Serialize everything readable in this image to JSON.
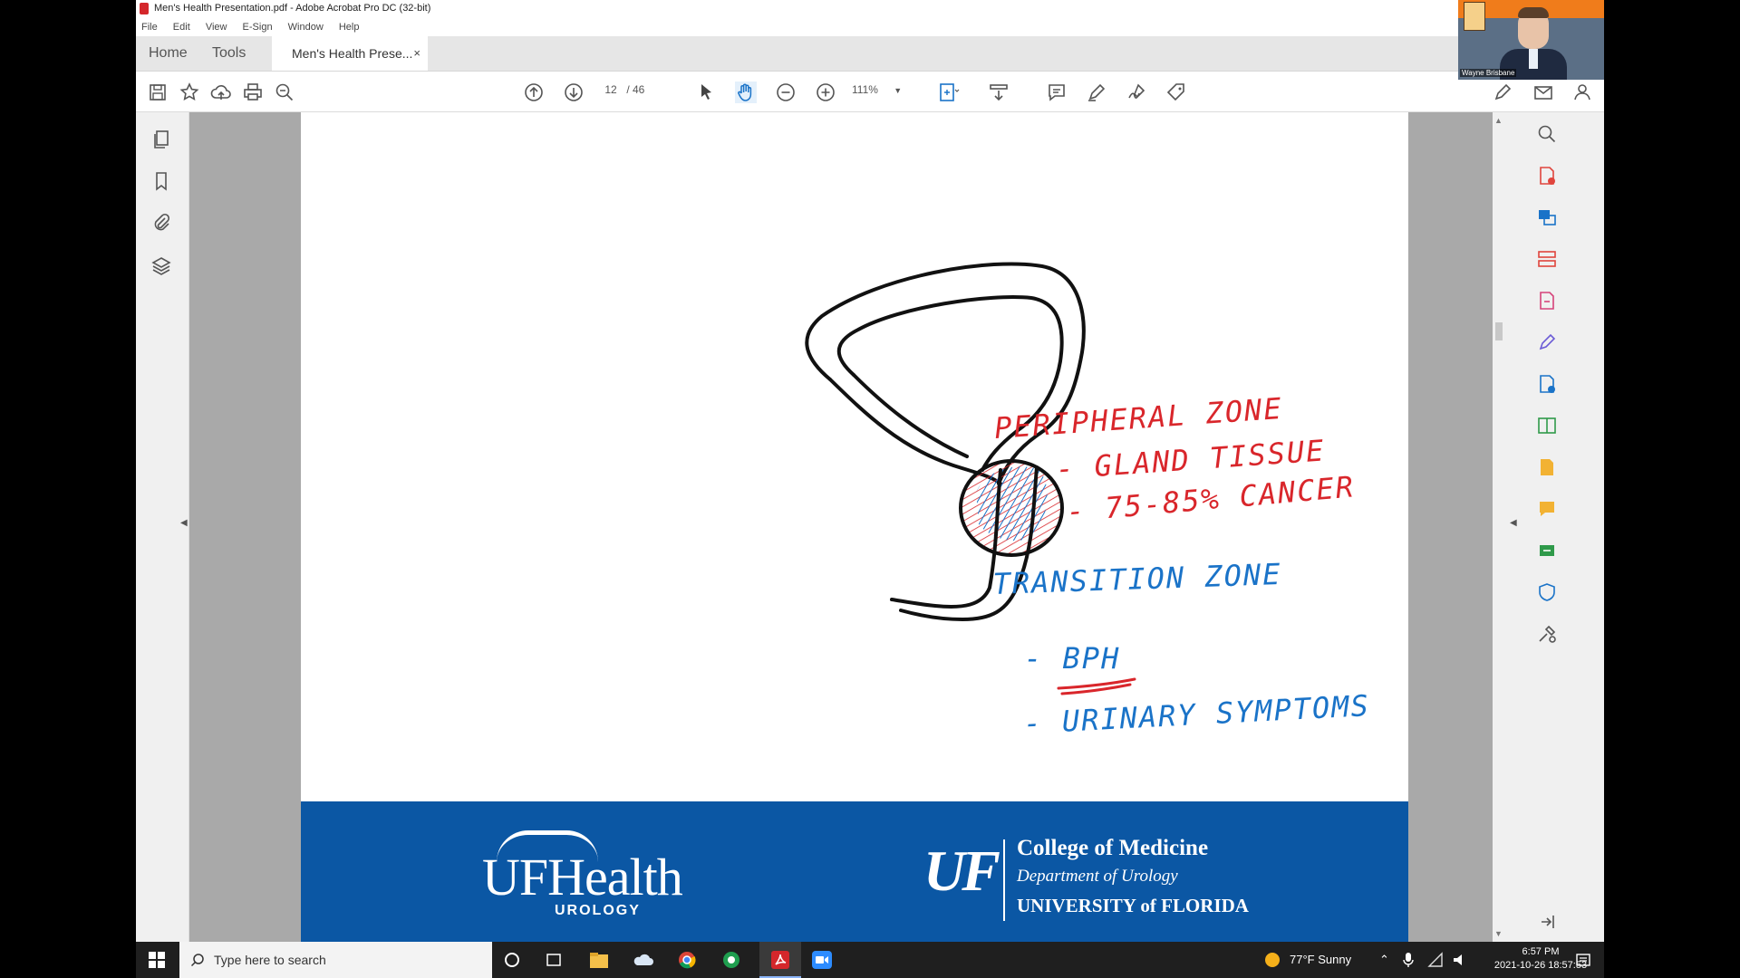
{
  "window": {
    "title": "Men's Health Presentation.pdf - Adobe Acrobat Pro DC (32-bit)"
  },
  "menu": [
    "File",
    "Edit",
    "View",
    "E-Sign",
    "Window",
    "Help"
  ],
  "tabs": {
    "home": "Home",
    "tools": "Tools",
    "document": "Men's Health Prese...",
    "close": "×"
  },
  "toolbar": {
    "page_current": "12",
    "page_total": "/ 46",
    "zoom": "111%"
  },
  "page": {
    "drawing_text": {
      "peripheral_title": "PERIPHERAL ZONE",
      "peripheral_item1": "- GLAND TISSUE",
      "peripheral_item2": "- 75-85% CANCER",
      "transition_title": "TRANSITION ZONE",
      "transition_item1": "- BPH",
      "transition_item2": "- URINARY SYMPTOMS"
    },
    "footer": {
      "ufhealth": "UFHealth",
      "urology": "UROLOGY",
      "uf_mark": "UF",
      "college": "College of Medicine",
      "department": "Department of Urology",
      "university": "UNIVERSITY of FLORIDA"
    }
  },
  "webcam": {
    "name": "Wayne Brisbane"
  },
  "taskbar": {
    "search_placeholder": "Type here to search",
    "weather": "77°F  Sunny",
    "time": "6:57 PM",
    "date": "2021-10-26 18:57:53"
  },
  "colors": {
    "peripheral_ink": "#d9262b",
    "transition_ink": "#1a73c8",
    "footer_blue": "#0b57a4",
    "acrobat_red": "#d4272b"
  }
}
